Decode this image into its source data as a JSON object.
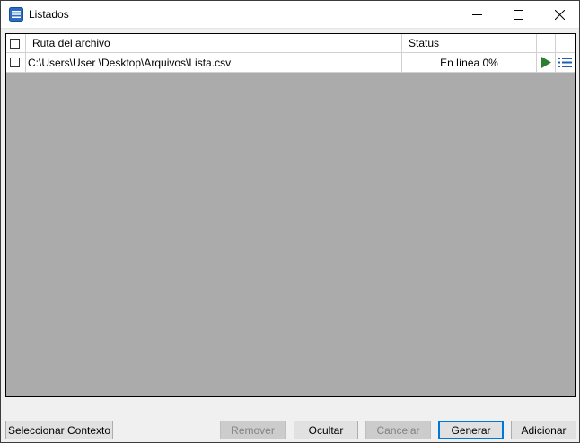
{
  "window": {
    "title": "Listados"
  },
  "grid": {
    "columns": [
      "Ruta del archivo",
      "Status"
    ],
    "rows": [
      {
        "path": "C:\\Users\\User \\Desktop\\Arquivos\\Lista.csv",
        "status": "En línea 0%"
      }
    ]
  },
  "buttons": {
    "seleccionar": "Seleccionar Contexto",
    "remover": "Remover",
    "ocultar": "Ocultar",
    "cancelar": "Cancelar",
    "generar": "Generar",
    "adicionar": "Adicionar"
  },
  "colors": {
    "play": "#2e7d32",
    "list_icon": "#1f5fb8",
    "default_button_border": "#0078d7",
    "grid_background": "#ababab"
  },
  "icons": [
    "list-app-icon",
    "minimize-icon",
    "maximize-icon",
    "close-icon",
    "play-icon",
    "list-details-icon"
  ]
}
